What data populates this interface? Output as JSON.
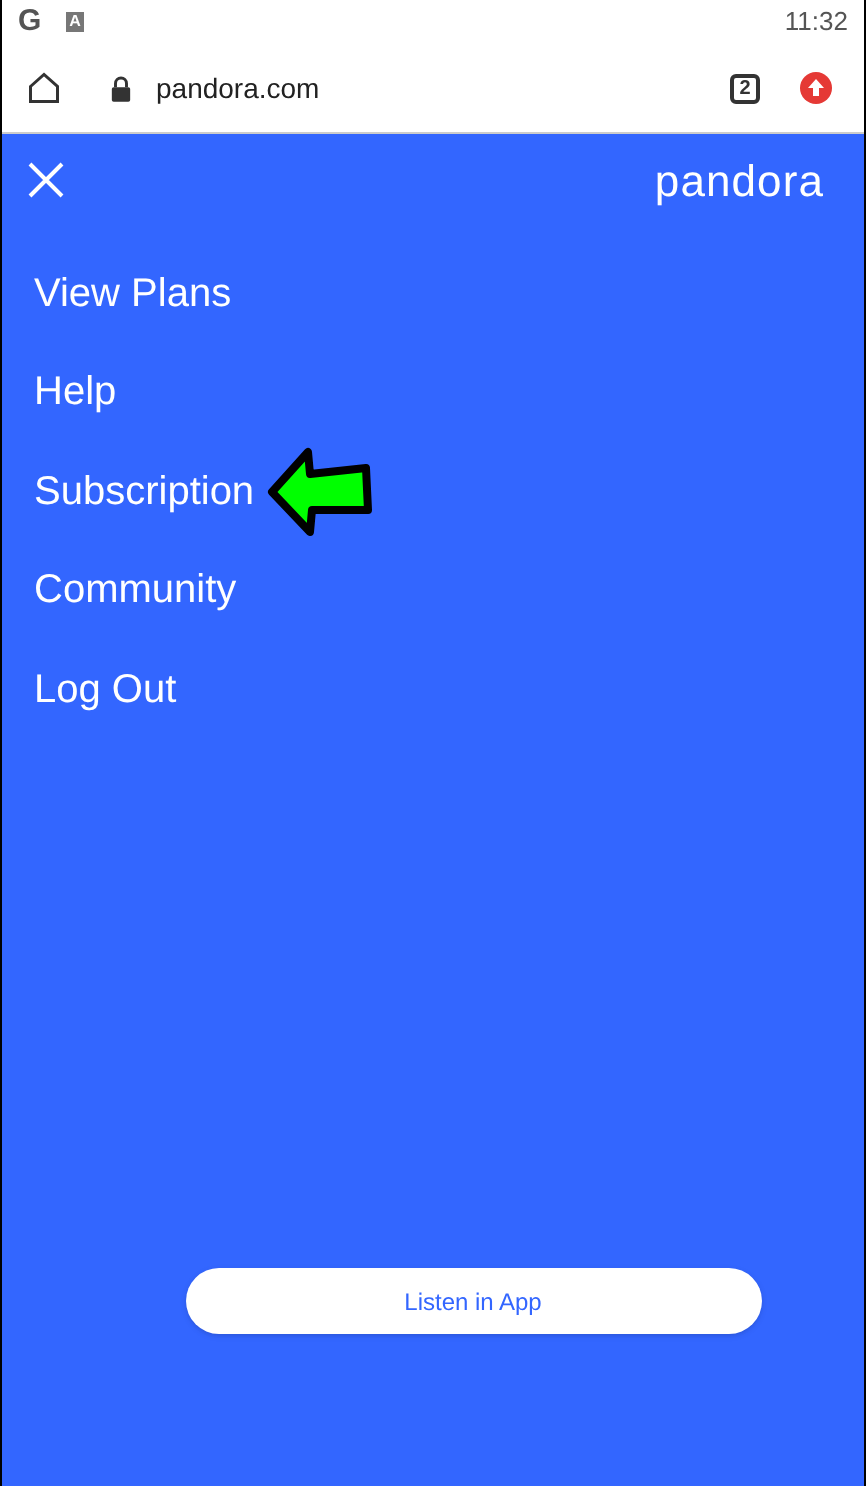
{
  "status_bar": {
    "icons": [
      "G",
      "A"
    ],
    "time": "11:32"
  },
  "browser": {
    "url": "pandora.com",
    "tab_count": "2"
  },
  "header": {
    "logo": "pandora"
  },
  "menu": [
    {
      "label": "View Plans",
      "pointed": false
    },
    {
      "label": "Help",
      "pointed": false
    },
    {
      "label": "Subscription",
      "pointed": true
    },
    {
      "label": "Community",
      "pointed": false
    },
    {
      "label": "Log Out",
      "pointed": false
    }
  ],
  "cta": "Listen in App"
}
